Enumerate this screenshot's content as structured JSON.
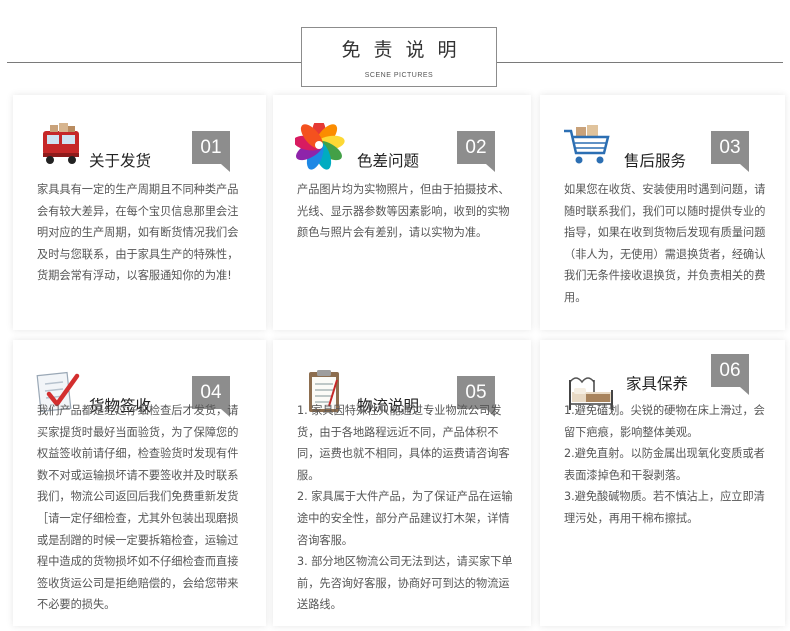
{
  "header": {
    "title": "免责说明",
    "subtitle": "SCENE PICTURES"
  },
  "cards": [
    {
      "number": "01",
      "title": "关于发货",
      "icon": "delivery-truck-icon",
      "body": [
        "家具具有一定的生产周期且不同种类产品会有较大差异，在每个宝贝信息那里会注明对应的生产周期，如有断货情况我们会及时与您联系，由于家具生产的特殊性，货期会常有浮动，以客服通知你的为准!"
      ]
    },
    {
      "number": "02",
      "title": "色差问题",
      "icon": "color-palette-icon",
      "body": [
        "产品图片均为实物照片，但由于拍摄技术、光线、显示器参数等因素影响，收到的实物颜色与照片会有差别，请以实物为准。"
      ]
    },
    {
      "number": "03",
      "title": "售后服务",
      "icon": "shopping-cart-icon",
      "body": [
        "如果您在收货、安装使用时遇到问题，请随时联系我们，我们可以随时提供专业的指导，如果在收到货物后发现有质量问题（非人为，无使用）需退换货者，经确认我们无条件接收退换货，并负责相关的费用。"
      ]
    },
    {
      "number": "04",
      "title": "货物签收",
      "icon": "checklist-icon",
      "body": [
        "我们产品都是经过仔细检查后才发货，请买家提货时最好当面验货，为了保障您的权益签收前请仔细，检查验货时发现有件数不对或运输损坏请不要签收并及时联系我们，物流公司返回后我们免费重新发货［请一定仔细检查，尤其外包装出现磨损或是刮蹭的时候一定要拆箱检查，运输过程中造成的货物损坏如不仔细检查而直接签收货运公司是拒绝赔偿的，会给您带来不必要的损失。"
      ]
    },
    {
      "number": "05",
      "title": "物流说明",
      "icon": "clipboard-icon",
      "body": [
        "1. 家具因特殊性只能通过专业物流公司发货，由于各地路程远近不同，产品体积不同，运费也就不相同，具体的运费请咨询客服。",
        "2. 家具属于大件产品，为了保证产品在运输途中的安全性，部分产品建议打木架，详情咨询客服。",
        "3. 部分地区物流公司无法到达，请买家下单前，先咨询好客服，协商好可到达的物流运送路线。"
      ]
    },
    {
      "number": "06",
      "title": "家具保养",
      "icon": "bed-icon",
      "body": [
        "1.避免磕划。尖锐的硬物在床上滑过，会留下疤痕，影响整体美观。",
        "2.避免直射。以防金属出现氧化变质或者表面漆掉色和干裂剥落。",
        "3.避免酸碱物质。若不慎沾上，应立即清理污处，再用干棉布擦拭。"
      ]
    }
  ]
}
